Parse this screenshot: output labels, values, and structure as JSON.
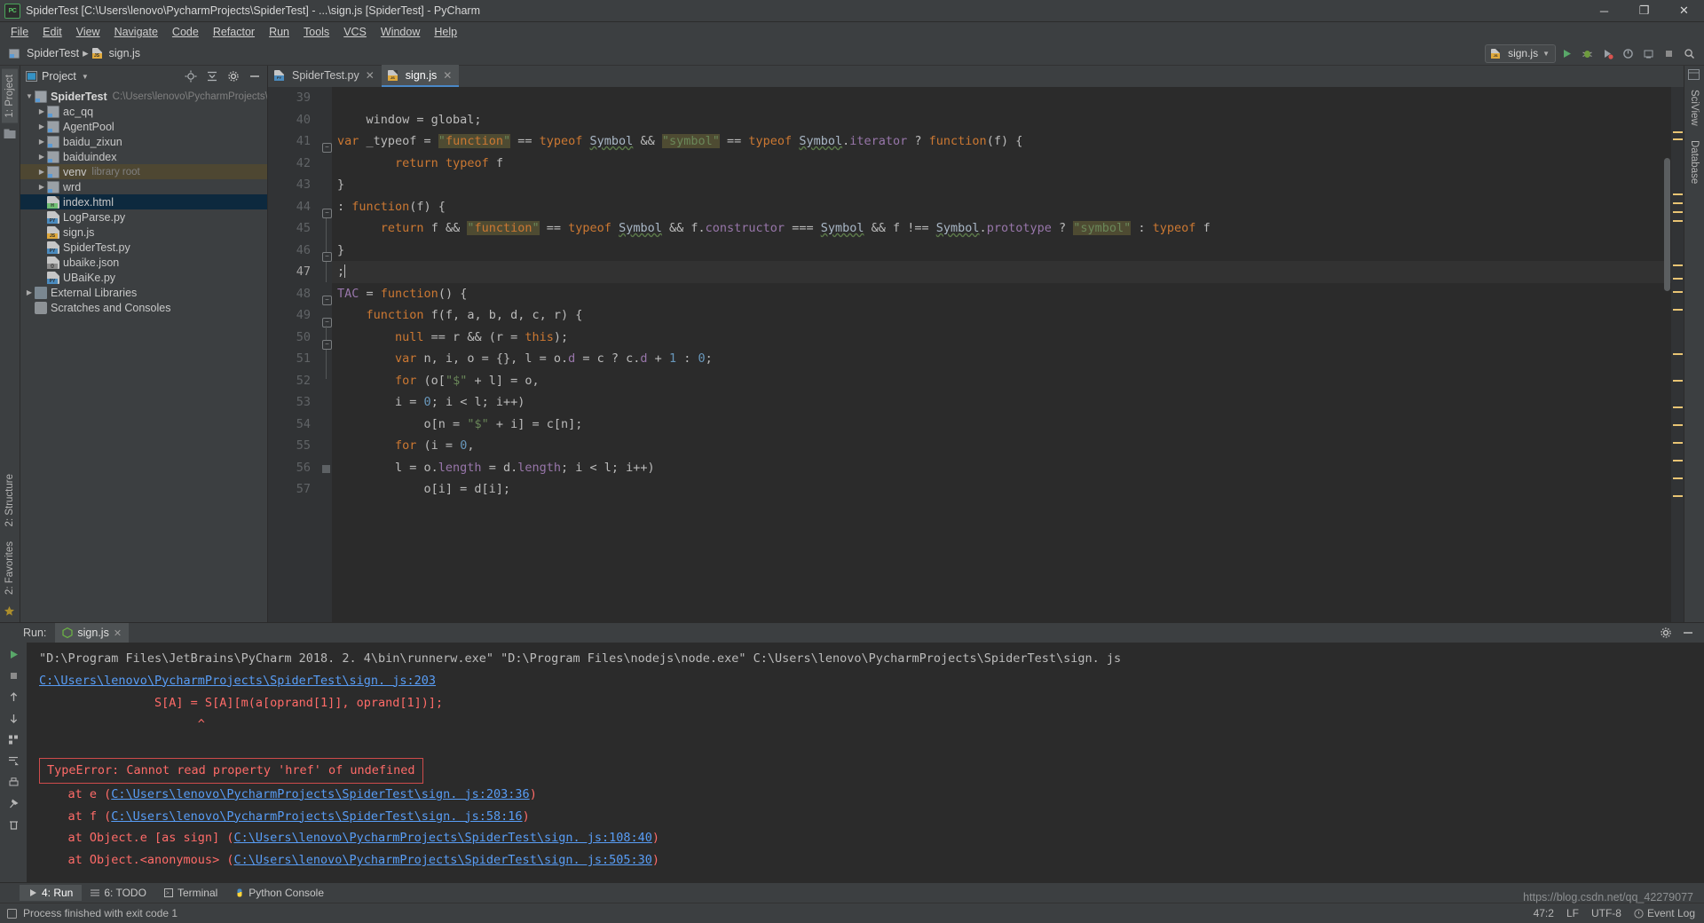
{
  "window": {
    "title": "SpiderTest [C:\\Users\\lenovo\\PycharmProjects\\SpiderTest] - ...\\sign.js [SpiderTest] - PyCharm",
    "logo": "PC",
    "minimize": "─",
    "maximize": "❐",
    "close": "✕"
  },
  "menubar": [
    {
      "label": "File",
      "mnemonic": "F"
    },
    {
      "label": "Edit",
      "mnemonic": "E"
    },
    {
      "label": "View",
      "mnemonic": "V"
    },
    {
      "label": "Navigate",
      "mnemonic": "N"
    },
    {
      "label": "Code",
      "mnemonic": "C"
    },
    {
      "label": "Refactor",
      "mnemonic": "R"
    },
    {
      "label": "Run",
      "mnemonic": "u"
    },
    {
      "label": "Tools",
      "mnemonic": "T"
    },
    {
      "label": "VCS",
      "mnemonic": "V"
    },
    {
      "label": "Window",
      "mnemonic": "W"
    },
    {
      "label": "Help",
      "mnemonic": "H"
    }
  ],
  "navbar": {
    "crumbs": [
      "SpiderTest",
      "sign.js"
    ],
    "run_config": "sign.js",
    "icons": [
      "run-icon",
      "debug-icon",
      "run-coverage-icon",
      "profile-icon",
      "attach-icon",
      "stop-icon",
      "search-icon"
    ]
  },
  "left_strip": {
    "project_tab": "1: Project",
    "structure_tab": "2: Structure",
    "favorites_tab": "2: Favorites"
  },
  "right_strip": {
    "sciview_tab": "SciView",
    "database_tab": "Database"
  },
  "project_panel": {
    "title": "Project",
    "tools": [
      "locate-icon",
      "collapse-all-icon",
      "settings-icon",
      "hide-icon"
    ],
    "tree": [
      {
        "depth": 0,
        "arrow": "▼",
        "icon": "folder",
        "label": "SpiderTest",
        "sub": "C:\\Users\\lenovo\\PycharmProjects\\Spider",
        "bold": true,
        "state": "normal"
      },
      {
        "depth": 1,
        "arrow": "▶",
        "icon": "folder",
        "label": "ac_qq",
        "sub": "",
        "bold": false,
        "state": "normal"
      },
      {
        "depth": 1,
        "arrow": "▶",
        "icon": "folder",
        "label": "AgentPool",
        "sub": "",
        "bold": false,
        "state": "normal"
      },
      {
        "depth": 1,
        "arrow": "▶",
        "icon": "folder",
        "label": "baidu_zixun",
        "sub": "",
        "bold": false,
        "state": "normal"
      },
      {
        "depth": 1,
        "arrow": "▶",
        "icon": "folder",
        "label": "baiduindex",
        "sub": "",
        "bold": false,
        "state": "normal"
      },
      {
        "depth": 1,
        "arrow": "▶",
        "icon": "folder",
        "label": "venv",
        "sub": "library root",
        "bold": false,
        "state": "highlight"
      },
      {
        "depth": 1,
        "arrow": "▶",
        "icon": "folder",
        "label": "wrd",
        "sub": "",
        "bold": false,
        "state": "normal"
      },
      {
        "depth": 1,
        "arrow": "",
        "icon": "html",
        "label": "index.html",
        "sub": "",
        "bold": false,
        "state": "selected"
      },
      {
        "depth": 1,
        "arrow": "",
        "icon": "py",
        "label": "LogParse.py",
        "sub": "",
        "bold": false,
        "state": "normal"
      },
      {
        "depth": 1,
        "arrow": "",
        "icon": "js",
        "label": "sign.js",
        "sub": "",
        "bold": false,
        "state": "normal"
      },
      {
        "depth": 1,
        "arrow": "",
        "icon": "py",
        "label": "SpiderTest.py",
        "sub": "",
        "bold": false,
        "state": "normal"
      },
      {
        "depth": 1,
        "arrow": "",
        "icon": "json",
        "label": "ubaike.json",
        "sub": "",
        "bold": false,
        "state": "normal"
      },
      {
        "depth": 1,
        "arrow": "",
        "icon": "py",
        "label": "UBaiKe.py",
        "sub": "",
        "bold": false,
        "state": "normal"
      },
      {
        "depth": 0,
        "arrow": "▶",
        "icon": "lib",
        "label": "External Libraries",
        "sub": "",
        "bold": false,
        "state": "normal"
      },
      {
        "depth": 0,
        "arrow": "",
        "icon": "scratch",
        "label": "Scratches and Consoles",
        "sub": "",
        "bold": false,
        "state": "normal"
      }
    ]
  },
  "editor": {
    "tabs": [
      {
        "label": "SpiderTest.py",
        "icon": "py",
        "active": false
      },
      {
        "label": "sign.js",
        "icon": "js",
        "active": true
      }
    ],
    "lines": [
      {
        "num": "39",
        "text": "",
        "current": false
      },
      {
        "num": "40",
        "text": "    window = global;",
        "current": false
      },
      {
        "num": "41",
        "text": "var _typeof = \"function\" == typeof Symbol && \"symbol\" == typeof Symbol.iterator ? function(f) {",
        "current": false
      },
      {
        "num": "42",
        "text": "        return typeof f",
        "current": false
      },
      {
        "num": "43",
        "text": "}",
        "current": false
      },
      {
        "num": "44",
        "text": ": function(f) {",
        "current": false
      },
      {
        "num": "45",
        "text": "      return f && \"function\" == typeof Symbol && f.constructor === Symbol && f !== Symbol.prototype ? \"symbol\" : typeof f",
        "current": false
      },
      {
        "num": "46",
        "text": "}",
        "current": false
      },
      {
        "num": "47",
        "text": ";",
        "current": true
      },
      {
        "num": "48",
        "text": "TAC = function() {",
        "current": false
      },
      {
        "num": "49",
        "text": "    function f(f, a, b, d, c, r) {",
        "current": false
      },
      {
        "num": "50",
        "text": "        null == r && (r = this);",
        "current": false
      },
      {
        "num": "51",
        "text": "        var n, i, o = {}, l = o.d = c ? c.d + 1 : 0;",
        "current": false
      },
      {
        "num": "52",
        "text": "        for (o[\"$\" + l] = o,",
        "current": false
      },
      {
        "num": "53",
        "text": "        i = 0; i < l; i++)",
        "current": false
      },
      {
        "num": "54",
        "text": "            o[n = \"$\" + i] = c[n];",
        "current": false
      },
      {
        "num": "55",
        "text": "        for (i = 0,",
        "current": false
      },
      {
        "num": "56",
        "text": "        l = o.length = d.length; i < l; i++)",
        "current": false
      },
      {
        "num": "57",
        "text": "            o[i] = d[i];",
        "current": false
      }
    ]
  },
  "run_panel": {
    "label": "Run:",
    "tab": "sign.js",
    "toolbar_icons": [
      "rerun-icon",
      "stop-icon",
      "up-stack-icon",
      "down-stack-icon",
      "soft-wrap-icon",
      "scroll-to-end-icon",
      "print-icon",
      "pin-icon",
      "clear-all-icon"
    ],
    "settings_icons": [
      "settings-icon",
      "hide-icon"
    ],
    "console": [
      {
        "type": "plain",
        "text": "\"D:\\Program Files\\JetBrains\\PyCharm 2018. 2. 4\\bin\\runnerw.exe\" \"D:\\Program Files\\nodejs\\node.exe\" C:\\Users\\lenovo\\PycharmProjects\\SpiderTest\\sign. js"
      },
      {
        "type": "link",
        "text": "C:\\Users\\lenovo\\PycharmProjects\\SpiderTest\\sign. js:203",
        "indent": 0
      },
      {
        "type": "err",
        "text": "                S[A] = S[A][m(a[oprand[1]], oprand[1])];",
        "indent": 0
      },
      {
        "type": "err",
        "text": "                      ^",
        "indent": 0
      },
      {
        "type": "blank",
        "text": ""
      },
      {
        "type": "errbox",
        "text": "TypeError: Cannot read property 'href' of undefined"
      },
      {
        "type": "trace",
        "prefix": "    at e (",
        "link": "C:\\Users\\lenovo\\PycharmProjects\\SpiderTest\\sign. js:203:36",
        "suffix": ")"
      },
      {
        "type": "trace",
        "prefix": "    at f (",
        "link": "C:\\Users\\lenovo\\PycharmProjects\\SpiderTest\\sign. js:58:16",
        "suffix": ")"
      },
      {
        "type": "trace",
        "prefix": "    at Object.e [as sign] (",
        "link": "C:\\Users\\lenovo\\PycharmProjects\\SpiderTest\\sign. js:108:40",
        "suffix": ")"
      },
      {
        "type": "trace",
        "prefix": "    at Object.<anonymous> (",
        "link": "C:\\Users\\lenovo\\PycharmProjects\\SpiderTest\\sign. js:505:30",
        "suffix": ")"
      }
    ]
  },
  "toolwindow_bar": [
    {
      "label": "4: Run",
      "mnemonic": "4",
      "icon": "run-icon",
      "active": true
    },
    {
      "label": "6: TODO",
      "mnemonic": "6",
      "icon": "todo-icon",
      "active": false
    },
    {
      "label": "Terminal",
      "mnemonic": "",
      "icon": "terminal-icon",
      "active": false
    },
    {
      "label": "Python Console",
      "mnemonic": "",
      "icon": "python-icon",
      "active": false
    }
  ],
  "statusbar": {
    "message": "Process finished with exit code 1",
    "caret": "47:2",
    "line_sep": "LF",
    "encoding": "UTF-8",
    "event_log": "Event Log"
  },
  "watermark": "https://blog.csdn.net/qq_42279077",
  "colors": {
    "background": "#3c3f41",
    "editor_bg": "#2b2b2b",
    "accent": "#4a88c7",
    "selection": "#0d293e",
    "error": "#ff6b68",
    "link": "#589df6",
    "keyword": "#cc7832",
    "string": "#6a8759",
    "number": "#6897bb"
  }
}
